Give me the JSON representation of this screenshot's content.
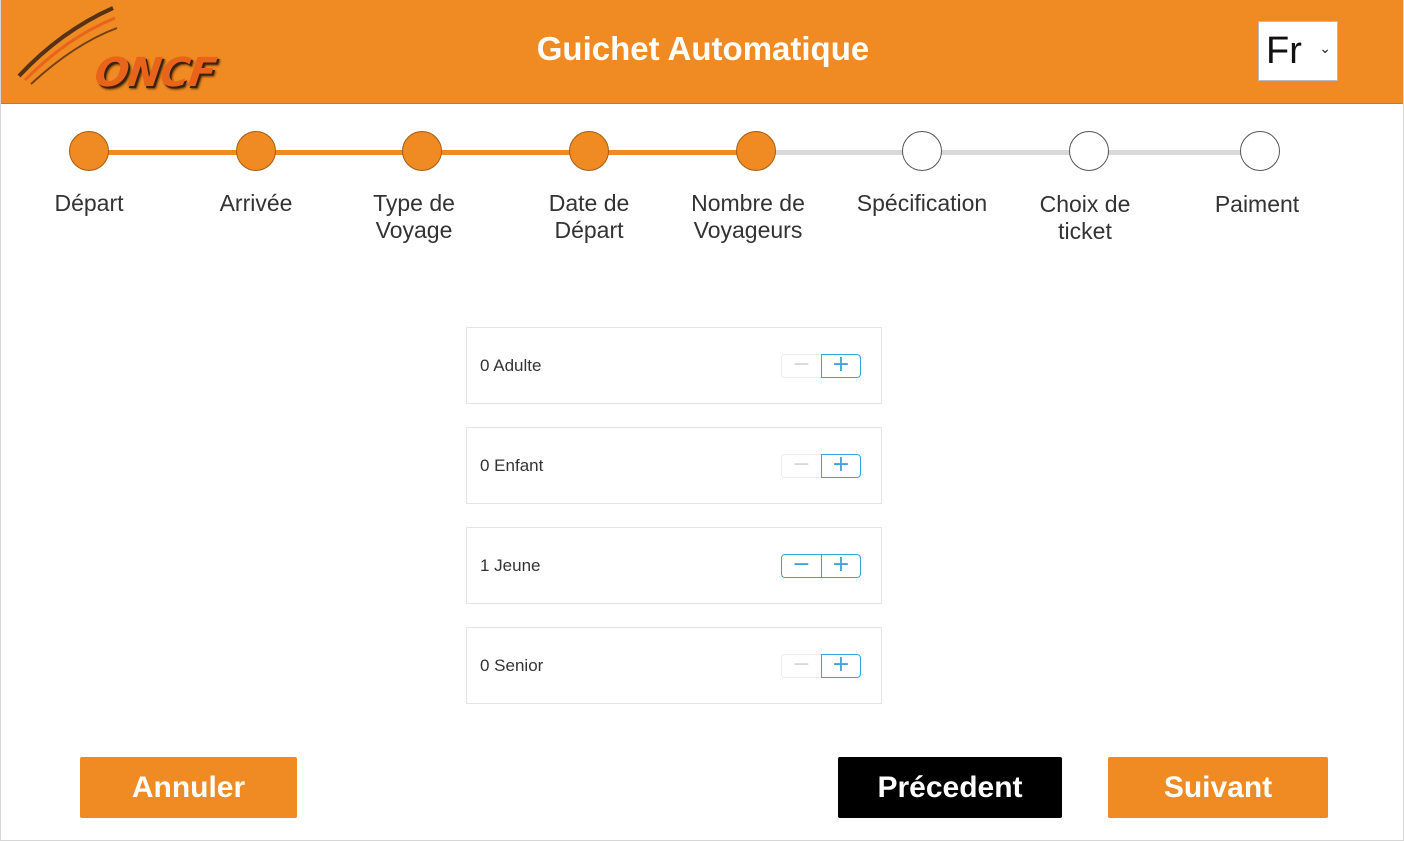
{
  "header": {
    "logo_text": "ONCF",
    "title": "Guichet Automatique",
    "language": {
      "selected": "Fr"
    }
  },
  "colors": {
    "accent": "#f08a22",
    "inactive_track": "#d9d9d9",
    "counter_button": "#3aa6d6"
  },
  "steps": [
    {
      "label": "Départ",
      "status": "done"
    },
    {
      "label": "Arrivée",
      "status": "done"
    },
    {
      "label": "Type de\nVoyage",
      "status": "done"
    },
    {
      "label": "Date de\nDépart",
      "status": "done"
    },
    {
      "label": "Nombre de\nVoyageurs",
      "status": "current"
    },
    {
      "label": "Spécification",
      "status": "todo"
    },
    {
      "label": "Choix de\nticket",
      "status": "todo"
    },
    {
      "label": "Paiment",
      "status": "todo"
    }
  ],
  "travelers": [
    {
      "label": "0 Adulte",
      "count": 0,
      "minus": "−",
      "plus": "+"
    },
    {
      "label": "0 Enfant",
      "count": 0,
      "minus": "−",
      "plus": "+"
    },
    {
      "label": "1 Jeune",
      "count": 1,
      "minus": "−",
      "plus": "+"
    },
    {
      "label": "0 Senior",
      "count": 0,
      "minus": "−",
      "plus": "+"
    }
  ],
  "actions": {
    "cancel_label": "Annuler",
    "previous_label": "Précedent",
    "next_label": "Suivant"
  }
}
